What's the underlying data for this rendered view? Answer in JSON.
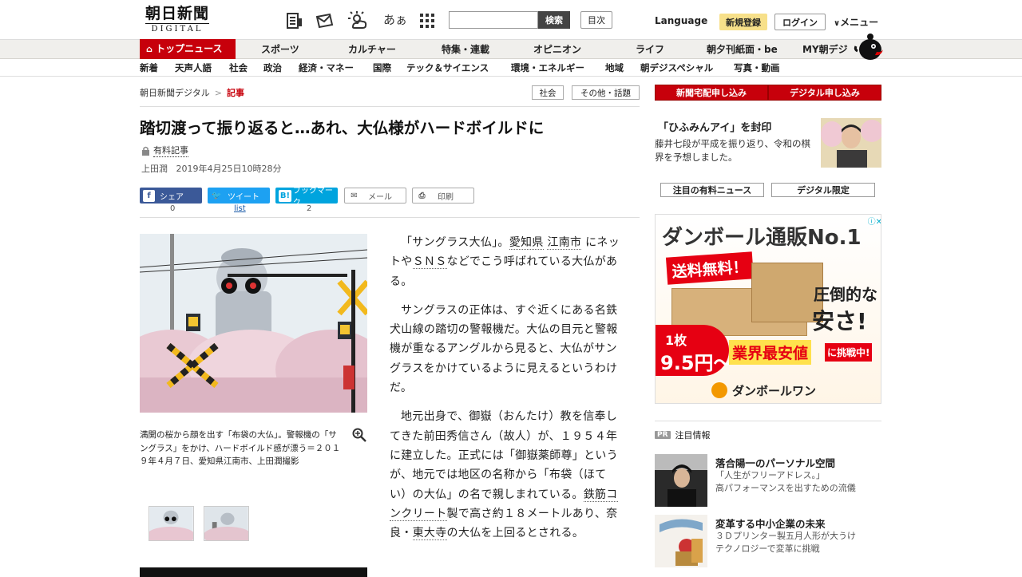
{
  "header": {
    "logo_line1": "朝日新聞",
    "logo_line2": "DIGITAL",
    "search_button": "検索",
    "toc_button": "目次",
    "language": "Language",
    "signup": "新規登録",
    "login": "ログイン",
    "menu": "メニュー",
    "icons": [
      "paper-icon",
      "mail-icon",
      "weather-icon",
      "font-size-icon",
      "grid-icon"
    ],
    "font_icon_text": "あぁ"
  },
  "nav1": [
    "トップニュース",
    "スポーツ",
    "カルチャー",
    "特集・連載",
    "オピニオン",
    "ライフ",
    "朝夕刊紙面・be",
    "MY朝デジ"
  ],
  "nav2": [
    "新着",
    "天声人語",
    "社会",
    "政治",
    "経済・マネー",
    "国際",
    "テック＆サイエンス",
    "環境・エネルギー",
    "地域",
    "朝デジスペシャル",
    "写真・動画"
  ],
  "breadcrumb": {
    "home": "朝日新聞デジタル",
    "sep": ">",
    "current": "記事"
  },
  "tags": [
    "社会",
    "その他・話題"
  ],
  "article": {
    "title": "踏切渡って振り返ると…あれ、大仏様がハードボイルドに",
    "paid": "有料記事",
    "author": "上田潤",
    "date": "2019年4月25日10時28分",
    "caption": "満開の桜から顔を出す「布袋の大仏」。警報機の「サングラス」をかけ、ハードボイルド感が漂う＝２０１９年４月７日、愛知県江南市、上田潤撮影",
    "p1_a": "「サングラス大仏」。",
    "p1_link1": "愛知県",
    "p1_link2": "江南市",
    "p1_b": "に",
    "p1_c": "ネットや",
    "p1_link3": "ＳＮＳ",
    "p1_d": "などでこう呼ばれている大仏がある。",
    "p2": "サングラスの正体は、すぐ近くにある名鉄犬山線の踏切の警報機だ。大仏の目元と警報機が重なるアングルから見ると、大仏がサングラスをかけているように見えるというわけだ。",
    "p3_a": "地元出身で、御嶽（おんたけ）教を信奉してきた前田秀信さん（故人）が、１９５４年に建立した。正式には「御嶽薬師尊」というが、地元では地区の名称から「布袋（ほてい）の大仏」の名で親しまれている。",
    "p3_link1": "鉄筋コンクリート",
    "p3_b": "製で高さ約１８メートルあり、奈良・",
    "p3_link2": "東大寺",
    "p3_c": "の大仏を上回るとされる。"
  },
  "share": {
    "facebook": "シェア",
    "facebook_count": "0",
    "twitter": "ツイート",
    "twitter_count": "list",
    "hatena": "ブックマーク",
    "hatena_count": "2",
    "hatena_icon": "B!",
    "mail": "メール",
    "print": "印刷"
  },
  "sidebar": {
    "btn1": "新聞宅配申し込み",
    "btn2": "デジタル申し込み",
    "feature_title": "「ひふみんアイ」を封印",
    "feature_desc": "藤井七段が平成を振り返り、令和の棋界を予想しました。",
    "tab1": "注目の有料ニュース",
    "tab2": "デジタル限定",
    "ad": {
      "headline": "ダンボール通販No.1",
      "free": "送料無料！",
      "cheap1": "圧倒的な",
      "cheap2": "安さ!",
      "unit": "1枚",
      "price": "9.5円〜",
      "challenge": "業界最安値",
      "challenge_suffix": "に挑戦中!",
      "brand": "ダンボールワン"
    },
    "pr_label": "PR",
    "pr_heading": "注目情報",
    "pr": [
      {
        "title": "落合陽一のパーソナル空間",
        "desc1": "「人生がフリーアドレス。」",
        "desc2": "高パフォーマンスを出すための流儀"
      },
      {
        "title": "変革する中小企業の未来",
        "desc1": "３Ｄプリンター製五月人形が大うけ",
        "desc2": "テクノロジーで変革に挑戦"
      }
    ]
  },
  "colors": {
    "accent_red": "#c7000b",
    "signup_yellow": "#f7e08a",
    "facebook": "#3b5998",
    "twitter": "#1da1f2",
    "hatena": "#00a4de"
  }
}
